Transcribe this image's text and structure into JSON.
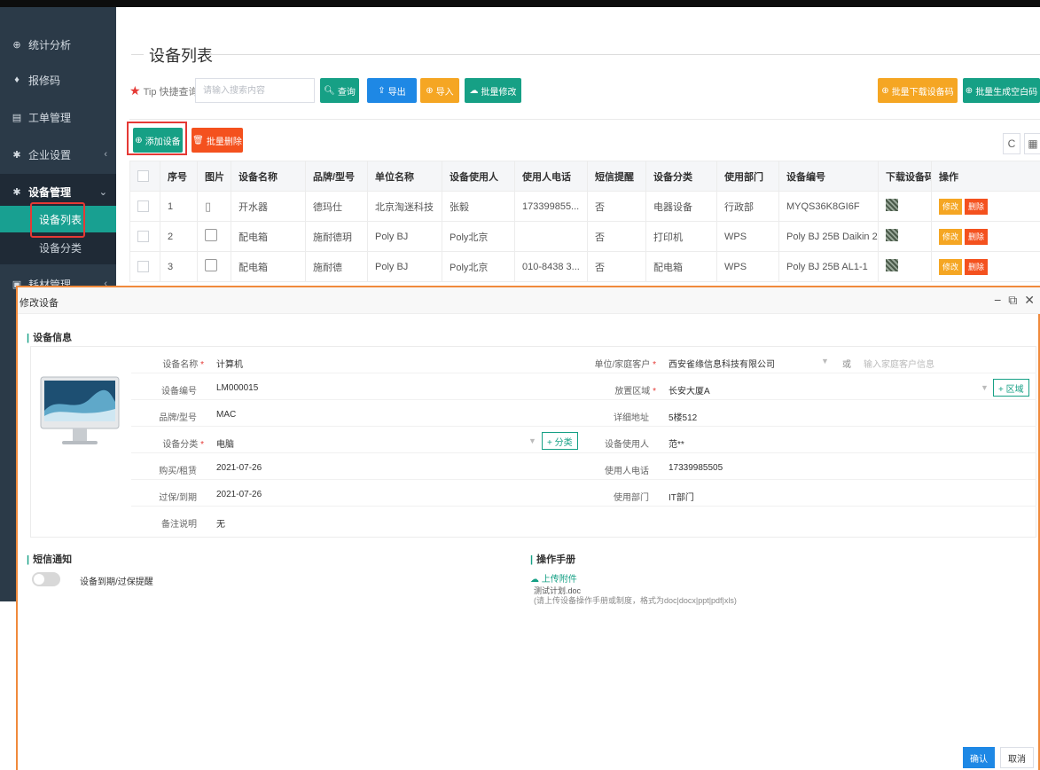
{
  "sidebar": {
    "items": [
      {
        "label": "统计分析",
        "icon": "globe-icon"
      },
      {
        "label": "报修码",
        "icon": "qrcode-icon"
      },
      {
        "label": "工单管理",
        "icon": "list-icon"
      },
      {
        "label": "企业设置",
        "icon": "gear-icon"
      },
      {
        "label": "设备管理",
        "icon": "gear-icon"
      },
      {
        "label": "耗材管理",
        "icon": "box-icon"
      }
    ],
    "sub_items": [
      {
        "label": "设备列表"
      },
      {
        "label": "设备分类"
      }
    ]
  },
  "page": {
    "title": "设备列表"
  },
  "search": {
    "tip": "Tip 快捷查询",
    "placeholder": "请输入搜索内容"
  },
  "toolbar": {
    "query": "查询",
    "export": "导出",
    "import": "导入",
    "batch_edit": "批量修改",
    "batch_download_qr": "批量下载设备码",
    "batch_gen_blank_qr": "批量生成空白码",
    "add_device": "添加设备",
    "batch_delete": "批量删除"
  },
  "table": {
    "headers": [
      "序号",
      "图片",
      "设备名称",
      "品牌/型号",
      "单位名称",
      "设备使用人",
      "使用人电话",
      "短信提醒",
      "设备分类",
      "使用部门",
      "设备编号",
      "下载设备码",
      "操作"
    ],
    "edit_label": "修改",
    "delete_label": "删除",
    "rows": [
      {
        "no": "1",
        "name": "开水器",
        "brand": "德玛仕",
        "unit": "北京淘迷科技",
        "user": "张毅",
        "phone": "173399855...",
        "sms": "否",
        "category": "电器设备",
        "dept": "行政部",
        "code": "MYQS36K8GI6F"
      },
      {
        "no": "2",
        "name": "配电箱",
        "brand": "施耐德玥",
        "unit": "Poly BJ",
        "user": "Poly北京",
        "phone": "",
        "sms": "否",
        "category": "打印机",
        "dept": "WPS",
        "code": "Poly BJ 25B Daikin 2"
      },
      {
        "no": "3",
        "name": "配电箱",
        "brand": "施耐德",
        "unit": "Poly BJ",
        "user": "Poly北京",
        "phone": "010-8438 3...",
        "sms": "否",
        "category": "配电箱",
        "dept": "WPS",
        "code": "Poly BJ 25B AL1-1"
      }
    ]
  },
  "modal": {
    "title": "修改设备",
    "section_info": "设备信息",
    "section_sms": "短信通知",
    "section_manual": "操作手册",
    "fields": {
      "name_label": "设备名称",
      "name_value": "计算机",
      "code_label": "设备编号",
      "code_value": "LM000015",
      "brand_label": "品牌/型号",
      "brand_value": "MAC",
      "category_label": "设备分类",
      "category_value": "电脑",
      "purchase_label": "购买/租赁",
      "purchase_value": "2021-07-26",
      "expire_label": "过保/到期",
      "expire_value": "2021-07-26",
      "remark_label": "备注说明",
      "remark_value": "无",
      "unit_label": "单位/家庭客户",
      "unit_value": "西安雀缘信息科技有限公司",
      "or_text": "或",
      "customer_placeholder": "输入家庭客户信息",
      "area_label": "放置区域",
      "area_value": "长安大厦A",
      "address_label": "详细地址",
      "address_value": "5楼512",
      "user_label": "设备使用人",
      "user_value": "范**",
      "phone_label": "使用人电话",
      "phone_value": "17339985505",
      "dept_label": "使用部门",
      "dept_value": "IT部门",
      "add_category": "+ 分类",
      "add_area": "+ 区域"
    },
    "sms_toggle_label": "设备到期/过保提醒",
    "upload_label": "上传附件",
    "file_name": "测试计划.doc",
    "file_hint": "(请上传设备操作手册或制度，格式为doc|docx|ppt|pdf|xls)",
    "ok": "确认",
    "cancel": "取消"
  },
  "colors": {
    "teal": "#16a085",
    "blue": "#1e88e5",
    "orange": "#f5a623",
    "red": "#f4511e",
    "sidebar": "#2b3a48",
    "modal_border": "#f08a3c"
  }
}
